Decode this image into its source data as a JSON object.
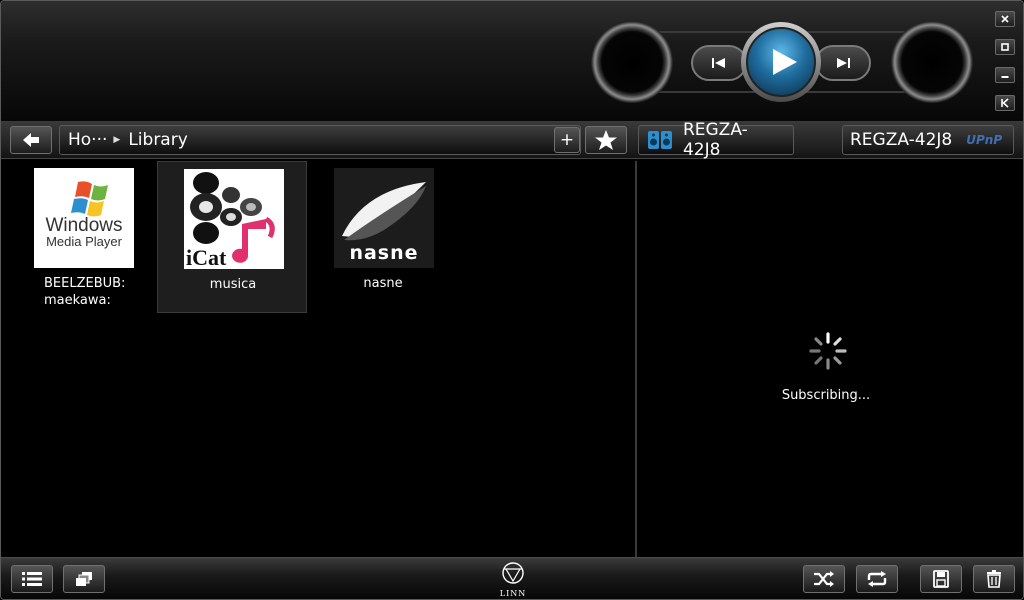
{
  "breadcrumb": {
    "home": "Ho···",
    "current": "Library"
  },
  "navbar": {
    "add_label": "+"
  },
  "rooms": {
    "active": "REGZA-42J8",
    "renderer": "REGZA-42J8",
    "protocol": "UPnP"
  },
  "library": {
    "items": [
      {
        "label": "BEELZEBUB:\nmaekawa:",
        "logo_line1": "Windows",
        "logo_line2": "Media Player",
        "selected": false
      },
      {
        "label": "musica",
        "logo_text": "iCat",
        "selected": true
      },
      {
        "label": "nasne",
        "logo_text": "nasne",
        "selected": false
      }
    ]
  },
  "playlist": {
    "status": "Subscribing..."
  },
  "footer": {
    "logo": "LINN"
  },
  "colors": {
    "accent_blue": "#2e8fcf",
    "icat_pink": "#e0316e",
    "upnp_blue": "#3f6fb5"
  }
}
